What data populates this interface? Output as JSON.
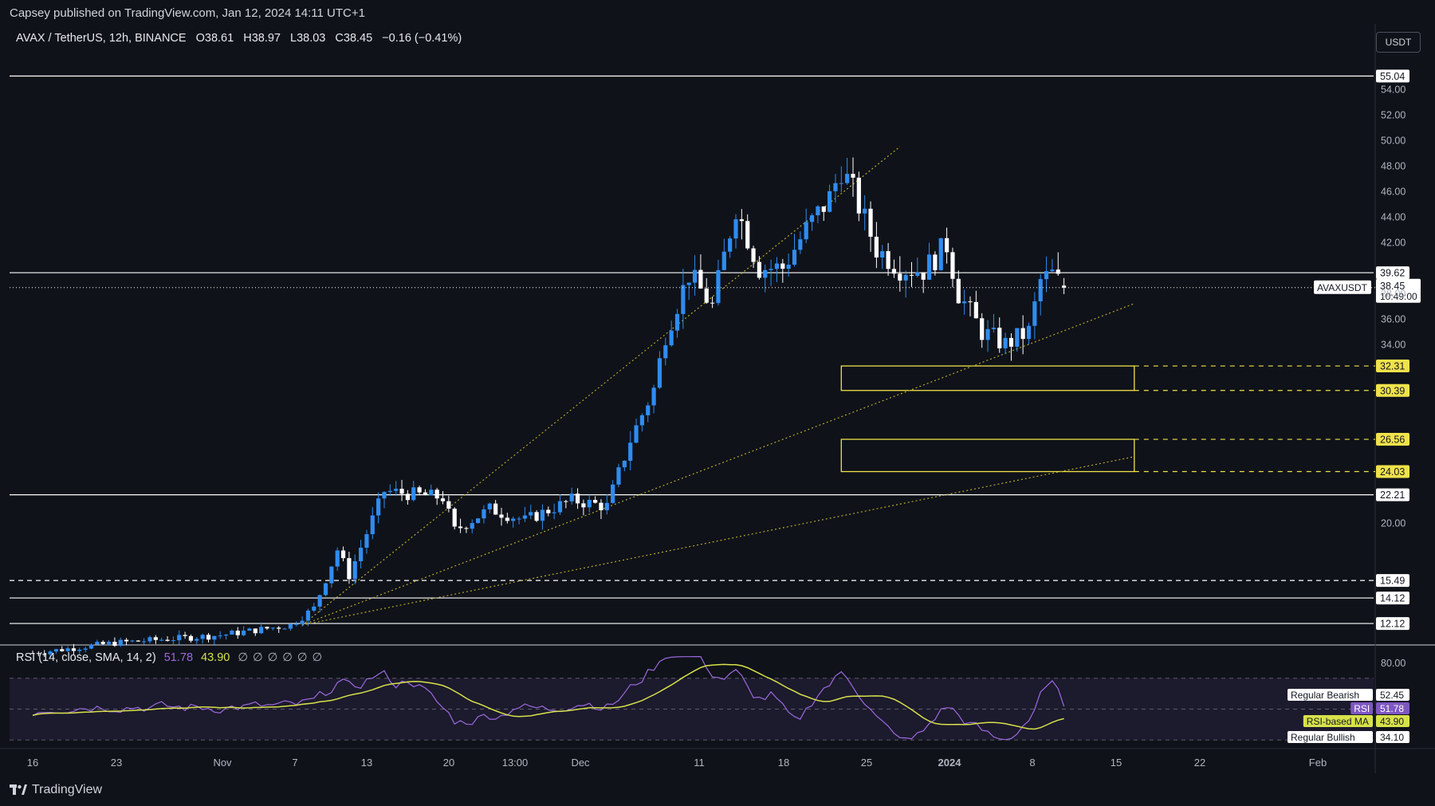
{
  "header": {
    "published": "Capsey published on TradingView.com, Jan 12, 2024 14:11 UTC+1"
  },
  "legend": {
    "symbol": "AVAX / TetherUS, 12h, BINANCE",
    "open": "O38.61",
    "high": "H38.97",
    "low": "L38.03",
    "close": "C38.45",
    "change": "−0.16 (−0.41%)"
  },
  "currency_button": "USDT",
  "rsi_legend": {
    "label": "RSI (14, close, SMA, 14, 2)",
    "rsi": "51.78",
    "ma": "43.90",
    "nulls": "∅∅∅∅∅∅"
  },
  "footer": {
    "brand": "TradingView"
  },
  "colors": {
    "background": "#0f1219",
    "up": "#2f8cf0",
    "down": "#ffffff",
    "level": "#ffffff",
    "zone": "#f0e24b",
    "trend": "#b8a92e",
    "rsi": "#9c6ade",
    "rsi_ma": "#d7e24b"
  },
  "chart_data": [
    {
      "type": "candlestick",
      "symbol": "AVAXUSDT",
      "timeframe": "12h",
      "price_axis": {
        "ylim": [
          10.5,
          56.5
        ],
        "ticks": [
          20.0,
          34.0,
          36.0,
          38.0,
          42.0,
          44.0,
          46.0,
          48.0,
          50.0,
          52.0,
          54.0
        ]
      },
      "x_ticks": [
        "16",
        "23",
        "Nov",
        "7",
        "13",
        "20",
        "13:00",
        "Dec",
        "11",
        "18",
        "25",
        "2024",
        "8",
        "15",
        "22",
        "Feb"
      ],
      "series": [
        {
          "name": "AVAX price",
          "checkpoints": [
            {
              "date": "2023-10-16",
              "close": 9.8
            },
            {
              "date": "2023-10-23",
              "close": 10.6
            },
            {
              "date": "2023-11-01",
              "close": 11.2
            },
            {
              "date": "2023-11-07",
              "close": 12.0
            },
            {
              "date": "2023-11-09",
              "close": 13.3
            },
            {
              "date": "2023-11-11",
              "close": 17.9
            },
            {
              "date": "2023-11-12",
              "close": 15.9
            },
            {
              "date": "2023-11-15",
              "close": 22.5
            },
            {
              "date": "2023-11-20",
              "close": 22.0
            },
            {
              "date": "2023-11-21",
              "close": 19.4
            },
            {
              "date": "2023-11-24",
              "close": 21.1
            },
            {
              "date": "2023-11-27",
              "close": 20.2
            },
            {
              "date": "2023-12-01",
              "close": 21.8
            },
            {
              "date": "2023-12-04",
              "close": 21.3
            },
            {
              "date": "2023-12-06",
              "close": 26.5
            },
            {
              "date": "2023-12-08",
              "close": 30.5
            },
            {
              "date": "2023-12-09",
              "close": 34.8
            },
            {
              "date": "2023-12-11",
              "close": 39.5
            },
            {
              "date": "2023-12-13",
              "close": 37.0
            },
            {
              "date": "2023-12-15",
              "close": 44.8
            },
            {
              "date": "2023-12-17",
              "close": 40.0
            },
            {
              "date": "2023-12-19",
              "close": 40.0
            },
            {
              "date": "2023-12-21",
              "close": 43.0
            },
            {
              "date": "2023-12-23",
              "close": 45.5
            },
            {
              "date": "2023-12-24",
              "close": 47.8
            },
            {
              "date": "2023-12-25",
              "close": 46.0
            },
            {
              "date": "2023-12-27",
              "close": 41.5
            },
            {
              "date": "2023-12-29",
              "close": 40.0
            },
            {
              "date": "2023-12-31",
              "close": 39.8
            },
            {
              "date": "2024-01-02",
              "close": 41.8
            },
            {
              "date": "2024-01-03",
              "close": 38.0
            },
            {
              "date": "2024-01-05",
              "close": 35.0
            },
            {
              "date": "2024-01-07",
              "close": 34.0
            },
            {
              "date": "2024-01-09",
              "close": 35.0
            },
            {
              "date": "2024-01-10",
              "close": 39.0
            },
            {
              "date": "2024-01-11",
              "close": 39.5
            },
            {
              "date": "2024-01-12",
              "close": 38.45
            }
          ]
        }
      ],
      "horizontal_levels": [
        {
          "value": 55.04,
          "label": "55.04",
          "style": "solid"
        },
        {
          "value": 39.62,
          "label": "39.62",
          "style": "solid"
        },
        {
          "value": 22.21,
          "label": "22.21",
          "style": "solid"
        },
        {
          "value": 15.49,
          "label": "15.49",
          "style": "dashed"
        },
        {
          "value": 14.12,
          "label": "14.12",
          "style": "solid"
        },
        {
          "value": 12.12,
          "label": "12.12",
          "style": "solid"
        }
      ],
      "zones": [
        {
          "top": 32.31,
          "bottom": 30.39,
          "from": "2023-12-24",
          "to": "2024-01-18"
        },
        {
          "top": 26.56,
          "bottom": 24.03,
          "from": "2023-12-24",
          "to": "2024-01-18"
        }
      ],
      "trendlines": [
        {
          "from": {
            "date": "2023-11-08",
            "value": 12.0
          },
          "to": {
            "date": "2023-12-29",
            "value": 49.5
          }
        },
        {
          "from": {
            "date": "2023-11-08",
            "value": 12.0
          },
          "to": {
            "date": "2024-01-18",
            "value": 37.2
          }
        },
        {
          "from": {
            "date": "2023-11-08",
            "value": 12.0
          },
          "to": {
            "date": "2024-01-18",
            "value": 25.2
          }
        }
      ],
      "last_price": {
        "label": "AVAXUSDT",
        "value": "38.45",
        "countdown": "10:49:00"
      }
    },
    {
      "type": "line",
      "title": "RSI (14, close, SMA, 14, 2)",
      "ylim": [
        25,
        90
      ],
      "y_ticks": [
        80.0
      ],
      "bands": {
        "upper": 70,
        "middle": 50,
        "lower": 30
      },
      "series": [
        {
          "name": "RSI",
          "last": 51.78
        },
        {
          "name": "RSI-based MA",
          "last": 43.9
        }
      ],
      "labels": [
        {
          "text": "Regular Bearish",
          "value": "52.45"
        },
        {
          "text": "RSI",
          "value": "51.78"
        },
        {
          "text": "RSI-based MA",
          "value": "43.90"
        },
        {
          "text": "Regular Bullish",
          "value": "34.10"
        }
      ]
    }
  ]
}
